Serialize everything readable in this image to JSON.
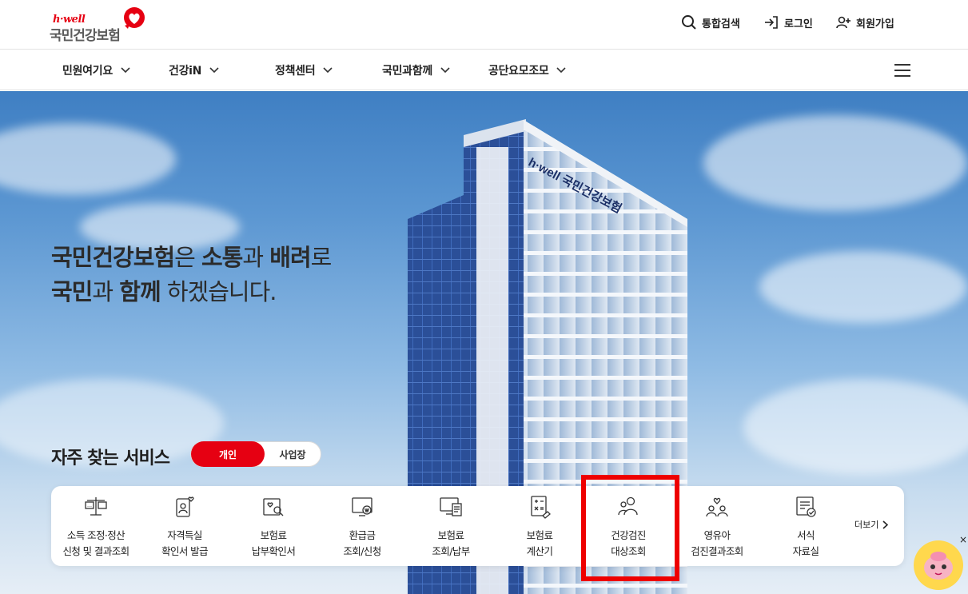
{
  "logo": {
    "tagline": "h·well",
    "name": "국민건강보험"
  },
  "utility": {
    "search": "통합검색",
    "login": "로그인",
    "signup": "회원가입"
  },
  "gnb": [
    "민원여기요",
    "건강iN",
    "정책센터",
    "국민과함께",
    "공단요모조모"
  ],
  "hero": {
    "line1_brand": "국민건강보험",
    "line1_p1": "은 ",
    "line1_w1": "소통",
    "line1_p2": "과 ",
    "line1_w2": "배려",
    "line1_p3": "로",
    "line2_w1": "국민",
    "line2_p1": "과 ",
    "line2_w2": "함께",
    "line2_p2": " 하겠습니다."
  },
  "building_sign": "h·well 국민건강보험",
  "services": {
    "title": "자주 찾는 서비스",
    "tab_active": "개인",
    "tab_inactive": "사업장",
    "more": "더보기",
    "items": [
      {
        "line1": "소득 조정·정산",
        "line2": "신청 및 결과조회",
        "icon": "scale-icon"
      },
      {
        "line1": "자격득실",
        "line2": "확인서 발급",
        "icon": "id-heart-icon"
      },
      {
        "line1": "보험료",
        "line2": "납부확인서",
        "icon": "search-document-icon"
      },
      {
        "line1": "환급금",
        "line2": "조회/신청",
        "icon": "monitor-won-icon"
      },
      {
        "line1": "보험료",
        "line2": "조회/납부",
        "icon": "monitor-doc-icon"
      },
      {
        "line1": "보험료",
        "line2": "계산기",
        "icon": "calculator-icon"
      },
      {
        "line1": "건강검진",
        "line2": "대상조회",
        "icon": "people-icon"
      },
      {
        "line1": "영유아",
        "line2": "검진결과조회",
        "icon": "family-icon"
      },
      {
        "line1": "서식",
        "line2": "자료실",
        "icon": "form-doc-icon"
      }
    ]
  },
  "chatbot_close": "×",
  "colors": {
    "brand_red": "#e60012",
    "highlight": "#ee0000"
  }
}
